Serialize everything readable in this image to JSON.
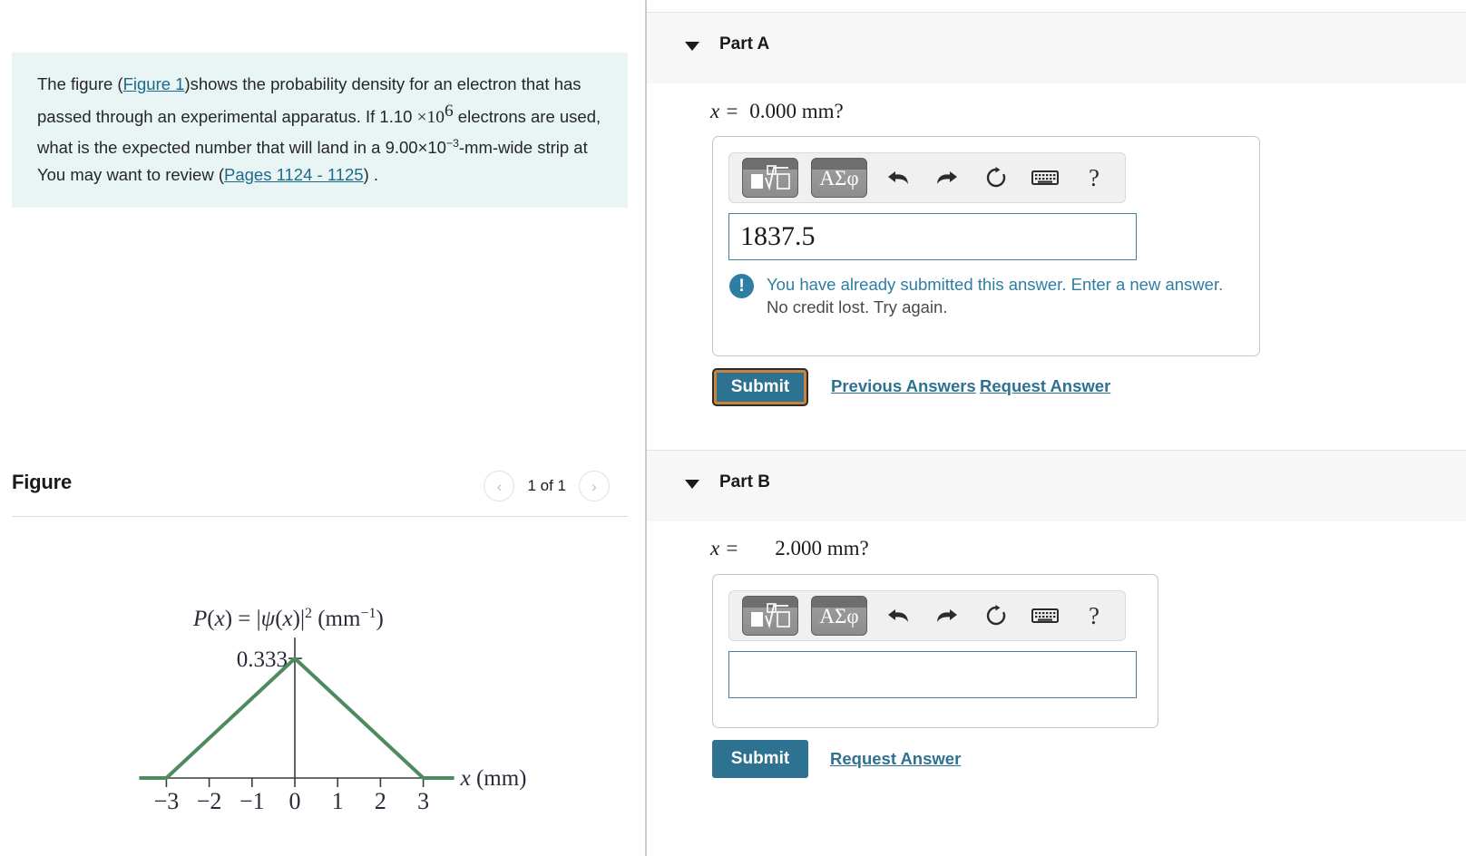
{
  "question": {
    "intro_1": "The figure (",
    "figure_link": "Figure 1",
    "intro_2": ")shows the probability density for an electron that has passed through an experimental apparatus. If 1.10 ",
    "mult": "×",
    "base10": "10",
    "exp6": "6",
    "intro_3": " electrons are used, what is the expected number that will land in a 9.00×10",
    "exp_neg3": "−3",
    "intro_4": "-mm-wide strip at You may want to review (",
    "pages_link": "Pages 1124 - 1125",
    "intro_5": ") ."
  },
  "figure": {
    "title": "Figure",
    "page_indicator": "1 of 1",
    "prev_icon": "‹",
    "next_icon": "›"
  },
  "chart_data": {
    "type": "line",
    "title": "P(x) = |ψ(x)|² (mm⁻¹)",
    "ylabel_value": "0.333",
    "xlabel": "x (mm)",
    "x": [
      -3,
      0,
      3
    ],
    "values": [
      0,
      0.333,
      0
    ],
    "xticks": [
      -3,
      -2,
      -1,
      0,
      1,
      2,
      3
    ],
    "xtick_labels": [
      "−3",
      "−2",
      "−1",
      "0",
      "1",
      "2",
      "3"
    ],
    "xlim": [
      -3.6,
      3.5
    ],
    "ylim": [
      0,
      0.4
    ],
    "line_color": "#4e8a61",
    "axis_color": "#3a3a3a",
    "grid": false,
    "legend": null,
    "peak": {
      "x": 0,
      "y": 0.333
    },
    "formula_parts": {
      "p": "P",
      "lparen": "(",
      "x": "x",
      "rparen": ")",
      "eq": "=",
      "psi": "ψ",
      "sq": "2",
      "units": "(mm",
      "units_exp": "−1",
      "units_close": ")"
    }
  },
  "parts": [
    {
      "id": "part-a",
      "label": "Part A",
      "caret_icon": "caret-down-icon",
      "prompt_lhs": "x =",
      "prompt_rhs": "0.000 mm?",
      "answer_value": "1837.5",
      "has_alert": true,
      "alert_line1": "You have already submitted this answer. Enter a new answer.",
      "alert_line2": "No credit lost. Try again.",
      "alert_icon": "!",
      "submit_label": "Submit",
      "submit_focused": true,
      "links": [
        "Previous Answers",
        "Request Answer"
      ]
    },
    {
      "id": "part-b",
      "label": "Part B",
      "caret_icon": "caret-down-icon",
      "prompt_lhs": "x =",
      "prompt_rhs": "2.000 mm?",
      "answer_value": "",
      "has_alert": false,
      "alert_line1": "",
      "alert_line2": "",
      "alert_icon": "",
      "submit_label": "Submit",
      "submit_focused": false,
      "links": [
        "Request Answer"
      ]
    }
  ],
  "toolbar": {
    "template_key": "template-icon",
    "greek_key": "ΑΣφ",
    "undo_icon": "↶",
    "redo_icon": "↷",
    "reset_icon": "↻",
    "keyboard_icon": "keyboard-icon",
    "help_icon": "?"
  },
  "colors": {
    "accent": "#2e7292",
    "question_bg": "#e9f4f4",
    "band_bg": "#f7f7f7",
    "focus_ring": "#c8833c",
    "curve": "#4e8a61"
  }
}
